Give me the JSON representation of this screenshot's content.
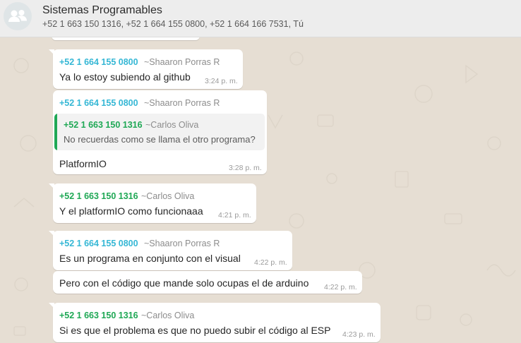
{
  "colors": {
    "blue": "#35b7d5",
    "green": "#1fa855"
  },
  "header": {
    "icon": "group-avatar-icon",
    "title": "Sistemas Programables",
    "members": "+52 1 663 150 1316, +52 1 664 155 0800, +52 1 664 166 7531, Tú"
  },
  "messages": [
    {
      "sender": "+52 1 664 155 0800",
      "name": "~Shaaron Porras R",
      "text": "Ya lo estoy subiendo al github",
      "time": "3:24 p. m."
    },
    {
      "sender": "+52 1 664 155 0800",
      "name": "~Shaaron Porras R",
      "quote": {
        "sender": "+52 1 663 150 1316",
        "name": "~Carlos Oliva",
        "text": "No recuerdas como se llama el otro programa?"
      },
      "text": "PlatformIO",
      "time": "3:28 p. m."
    },
    {
      "sender": "+52 1 663 150 1316",
      "name": "~Carlos Oliva",
      "text": "Y el platformIO como funcionaaa",
      "time": "4:21 p. m."
    },
    {
      "sender": "+52 1 664 155 0800",
      "name": "~Shaaron Porras R",
      "text": "Es un programa en conjunto con el visual",
      "time": "4:22 p. m."
    },
    {
      "text": "Pero con el código que mande solo ocupas el de arduino",
      "time": "4:22 p. m."
    },
    {
      "sender": "+52 1 663 150 1316",
      "name": "~Carlos Oliva",
      "text": "Si es que el problema es que no puedo subir el código al ESP",
      "time": "4:23 p. m."
    }
  ]
}
